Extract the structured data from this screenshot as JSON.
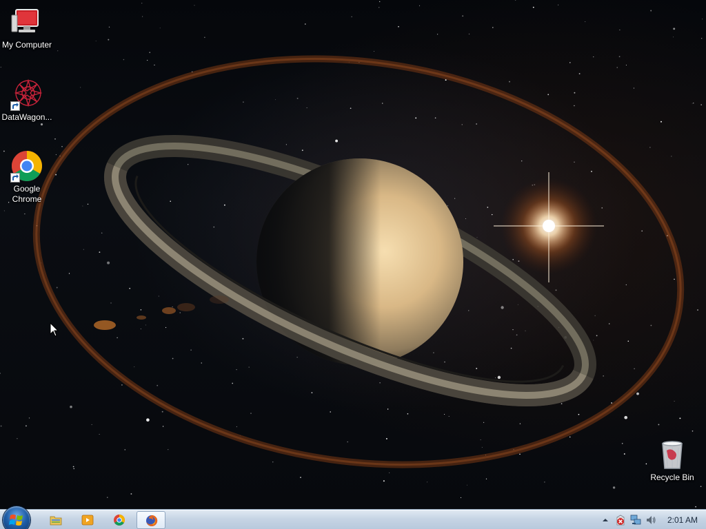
{
  "desktop": {
    "icons": [
      {
        "label": "My Computer",
        "icon": "computer-icon"
      },
      {
        "label": "DataWagon...",
        "icon": "datawagon-icon"
      },
      {
        "label": "Google Chrome",
        "icon": "chrome-icon"
      },
      {
        "label": "Recycle Bin",
        "icon": "recycle-bin-icon"
      }
    ]
  },
  "taskbar": {
    "start": {
      "icon": "windows-logo-icon"
    },
    "pinned": [
      {
        "icon": "folder-explorer-icon"
      },
      {
        "icon": "media-player-icon"
      },
      {
        "icon": "chrome-icon"
      },
      {
        "icon": "firefox-icon",
        "active": true
      }
    ],
    "tray": {
      "icons": [
        "show-hidden-icons-arrow",
        "security-alert-icon",
        "network-icon",
        "volume-icon"
      ],
      "clock": "2:01 AM"
    }
  },
  "colors": {
    "taskbar": "#c6d4e4",
    "accent": "#1f5ea8",
    "alert": "#d22a2a"
  }
}
